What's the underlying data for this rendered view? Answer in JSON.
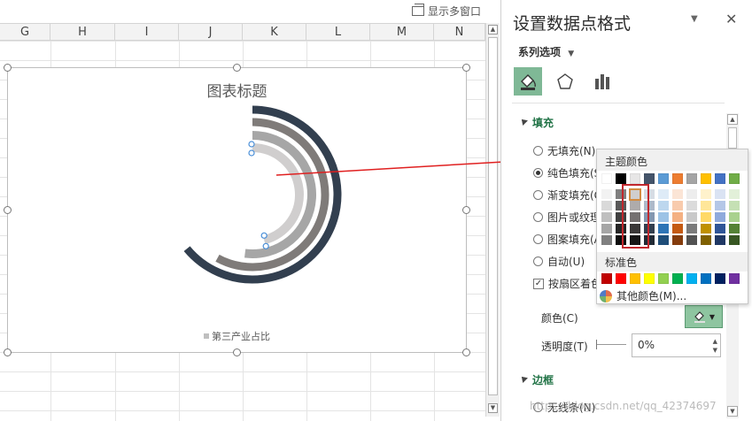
{
  "topbar": {
    "multi_window": "显示多窗口"
  },
  "columns": [
    "G",
    "H",
    "I",
    "J",
    "K",
    "L",
    "M",
    "N"
  ],
  "chart": {
    "title": "图表标题",
    "legend": "第三产业占比",
    "rings": [
      {
        "color": "#323f4f",
        "fraction": 0.64
      },
      {
        "color": "#7f7b79",
        "fraction": 0.58
      },
      {
        "color": "#a6a6a6",
        "fraction": 0.52
      },
      {
        "color": "#d0cece",
        "fraction": 0.46
      }
    ]
  },
  "pane": {
    "title": "设置数据点格式",
    "series_options": "系列选项",
    "tabs": [
      "fill-line-icon",
      "effects-icon",
      "series-options-icon"
    ],
    "fill_section": "填充",
    "fill_options": [
      {
        "label": "无填充(N)",
        "selected": false
      },
      {
        "label": "纯色填充(S)",
        "selected": true
      },
      {
        "label": "渐变填充(G)",
        "selected": false
      },
      {
        "label": "图片或纹理填充(P)",
        "selected": false
      },
      {
        "label": "图案填充(A)",
        "selected": false
      },
      {
        "label": "自动(U)",
        "selected": false
      }
    ],
    "vary_colors": "按扇区着色(V)",
    "color_label": "颜色(C)",
    "transparency_label": "透明度(T)",
    "transparency_value": "0%",
    "border_section": "边框",
    "no_line": "无线条(N)"
  },
  "popup": {
    "theme_title": "主题颜色",
    "theme_colors": [
      "#ffffff",
      "#000000",
      "#e7e6e6",
      "#44546a",
      "#5b9bd5",
      "#ed7d31",
      "#a5a5a5",
      "#ffc000",
      "#4472c4",
      "#70ad47"
    ],
    "theme_shades": [
      [
        "#f2f2f2",
        "#d9d9d9",
        "#bfbfbf",
        "#a6a6a6",
        "#808080"
      ],
      [
        "#7f7f7f",
        "#595959",
        "#404040",
        "#262626",
        "#0d0d0d"
      ],
      [
        "#d0cece",
        "#aeabab",
        "#757171",
        "#3a3838",
        "#161616"
      ],
      [
        "#d6dce4",
        "#adb9ca",
        "#8497b0",
        "#333f4f",
        "#222a35"
      ],
      [
        "#deebf7",
        "#bdd7ee",
        "#9dc3e6",
        "#2e75b6",
        "#1f4e79"
      ],
      [
        "#fbe5d6",
        "#f8cbad",
        "#f4b183",
        "#c55a11",
        "#843c0c"
      ],
      [
        "#ededed",
        "#dbdbdb",
        "#c9c9c9",
        "#7b7b7b",
        "#525252"
      ],
      [
        "#fff2cc",
        "#ffe699",
        "#ffd966",
        "#bf9000",
        "#7f6000"
      ],
      [
        "#dae3f3",
        "#b4c7e7",
        "#8faadc",
        "#2f5597",
        "#203864"
      ],
      [
        "#e2f0d9",
        "#c5e0b4",
        "#a9d18e",
        "#548235",
        "#385723"
      ]
    ],
    "standard_title": "标准色",
    "standard_colors": [
      "#c00000",
      "#ff0000",
      "#ffc000",
      "#ffff00",
      "#92d050",
      "#00b050",
      "#00b0f0",
      "#0070c0",
      "#002060",
      "#7030a0"
    ],
    "more_colors": "其他颜色(M)..."
  },
  "watermark": "https://blog.csdn.net/qq_42374697",
  "colors": {
    "accent": "#217346",
    "active_tab": "#7fb896",
    "highlight": "#c1272d"
  }
}
